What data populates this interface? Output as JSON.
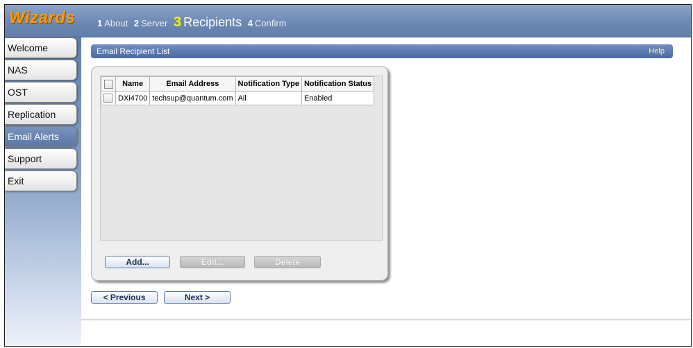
{
  "brand": "Wizards",
  "steps": [
    {
      "num": "1",
      "label": "About"
    },
    {
      "num": "2",
      "label": "Server"
    },
    {
      "num": "3",
      "label": "Recipients"
    },
    {
      "num": "4",
      "label": "Confirm"
    }
  ],
  "active_step": "Recipients",
  "sidebar": {
    "items": [
      {
        "label": "Welcome"
      },
      {
        "label": "NAS"
      },
      {
        "label": "OST"
      },
      {
        "label": "Replication"
      },
      {
        "label": "Email Alerts"
      },
      {
        "label": "Support"
      },
      {
        "label": "Exit"
      }
    ],
    "active": "Email Alerts"
  },
  "section": {
    "title": "Email Recipient List",
    "help": "Help"
  },
  "table": {
    "columns": [
      "Name",
      "Email Address",
      "Notification Type",
      "Notification Status"
    ],
    "rows": [
      {
        "name": "DXi4700",
        "email": "techsup@quantum.com",
        "type": "All",
        "status": "Enabled"
      }
    ]
  },
  "actions": {
    "add": "Add...",
    "edit": "Edit...",
    "delete": "Delete"
  },
  "nav": {
    "previous": "< Previous",
    "next": "Next >"
  },
  "colors": {
    "brand": "#ff9a00",
    "active_step": "#fff200",
    "header_bar": "#5f7eab",
    "help_link": "#ffff66"
  }
}
